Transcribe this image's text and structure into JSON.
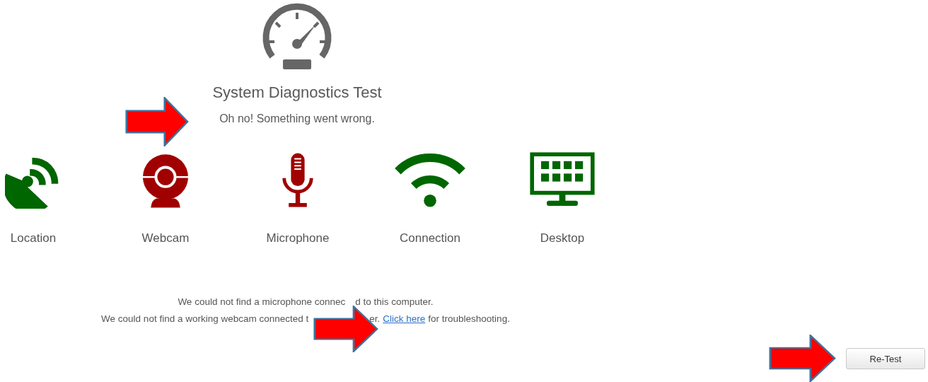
{
  "header": {
    "title": "System Diagnostics Test",
    "subtitle": "Oh no! Something went wrong."
  },
  "checks": [
    {
      "kind": "location",
      "label": "Location",
      "color": "#006600"
    },
    {
      "kind": "webcam",
      "label": "Webcam",
      "color": "#a00000"
    },
    {
      "kind": "microphone",
      "label": "Microphone",
      "color": "#a00000"
    },
    {
      "kind": "connection",
      "label": "Connection",
      "color": "#006600"
    },
    {
      "kind": "desktop",
      "label": "Desktop",
      "color": "#006600"
    }
  ],
  "messages": [
    {
      "segments": [
        {
          "kind": "text",
          "text": "We could not find a microphone connec"
        },
        {
          "kind": "text",
          "text": "d to this computer."
        }
      ]
    },
    {
      "segments": [
        {
          "kind": "text",
          "text": "We could not find a working webcam connected t"
        },
        {
          "kind": "text",
          "text": "er."
        },
        {
          "kind": "link",
          "text": "Click here"
        },
        {
          "kind": "text",
          "text": "for troubleshooting."
        }
      ]
    }
  ],
  "retest_button": "Re-Test"
}
